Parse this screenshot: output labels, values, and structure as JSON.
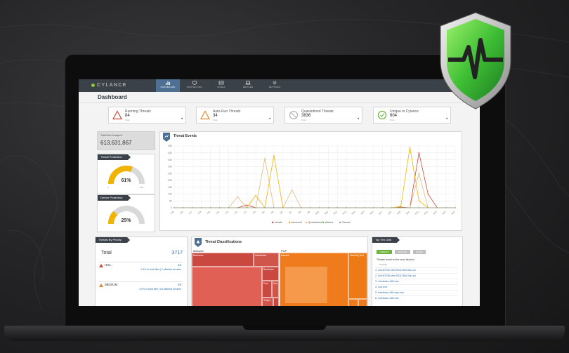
{
  "app": {
    "brand": "CYLANCE",
    "page_title": "Dashboard"
  },
  "nav": [
    {
      "label": "DASHBOARD",
      "icon": "bar-chart-icon",
      "active": true
    },
    {
      "label": "PROTECTION",
      "icon": "shield-icon",
      "active": false
    },
    {
      "label": "ZONES",
      "icon": "zones-icon",
      "active": false
    },
    {
      "label": "DEVICES",
      "icon": "laptop-icon",
      "active": false
    },
    {
      "label": "SETTINGS",
      "icon": "gear-icon",
      "active": false
    }
  ],
  "stats": [
    {
      "label": "Running Threats",
      "value": "84",
      "sub": "Total",
      "icon": "warning-icon",
      "color": "#d0463b"
    },
    {
      "label": "Auto-Run Threats",
      "value": "34",
      "sub": "Total",
      "icon": "warning-icon",
      "color": "#e08a2b"
    },
    {
      "label": "Quarantined Threats",
      "value": "3836",
      "sub": "Total",
      "icon": "blocked-icon",
      "color": "#b5b5b5"
    },
    {
      "label": "Unique to Cylance",
      "value": "604",
      "sub": "Total",
      "icon": "cylance-icon",
      "color": "#6bb33a"
    }
  ],
  "files": {
    "label": "Total Files Analyzed",
    "value": "613,631,867"
  },
  "gauges": {
    "threat": {
      "title": "Threat Protection",
      "percent": 61,
      "display": "61%",
      "color": "#f0b400",
      "min": "0",
      "max": "100"
    },
    "device": {
      "title": "Device Protection",
      "percent": 25,
      "display": "25%",
      "color": "#f0b400",
      "min": "0",
      "max": "100"
    }
  },
  "threat_events": {
    "title": "Threat Events",
    "chart_data": {
      "type": "line",
      "x": [
        "7/25",
        "7/26",
        "7/27",
        "7/28",
        "7/29",
        "7/30",
        "7/31",
        "8/1",
        "8/2",
        "8/3",
        "8/4",
        "8/5",
        "8/6",
        "8/7",
        "8/8",
        "8/9",
        "8/10",
        "8/11",
        "8/12",
        "8/13",
        "8/14",
        "8/15",
        "8/16",
        "8/17",
        "8/18",
        "8/19",
        "8/20",
        "8/21",
        "8/22",
        "8/23",
        "8/24",
        "8/25"
      ],
      "ylim": [
        0,
        450
      ],
      "yticks": [
        0,
        50,
        100,
        150,
        200,
        250,
        300,
        350,
        400,
        450
      ],
      "series": [
        {
          "name": "Unsafe",
          "color": "#d0463b",
          "values": [
            0,
            0,
            0,
            0,
            0,
            0,
            0,
            0,
            20,
            0,
            0,
            0,
            0,
            0,
            0,
            0,
            0,
            0,
            0,
            0,
            0,
            0,
            0,
            0,
            0,
            5,
            0,
            400,
            100,
            0,
            0,
            0
          ]
        },
        {
          "name": "Abnormal",
          "color": "#f0b400",
          "values": [
            0,
            0,
            0,
            0,
            0,
            0,
            0,
            0,
            0,
            90,
            0,
            380,
            0,
            0,
            0,
            0,
            0,
            0,
            0,
            0,
            0,
            0,
            0,
            0,
            0,
            10,
            440,
            50,
            0,
            0,
            0,
            0
          ]
        },
        {
          "name": "Quarantined",
          "color": "#e4b880",
          "values": [
            0,
            0,
            0,
            0,
            0,
            0,
            0,
            80,
            0,
            0,
            360,
            0,
            0,
            130,
            0,
            0,
            0,
            0,
            0,
            0,
            0,
            0,
            0,
            0,
            0,
            0,
            0,
            250,
            0,
            0,
            0,
            0
          ]
        },
        {
          "name": "Waived",
          "color": "#6bb33a",
          "values": [
            0,
            0,
            0,
            0,
            0,
            0,
            0,
            0,
            0,
            0,
            0,
            0,
            0,
            0,
            0,
            0,
            0,
            0,
            0,
            0,
            0,
            0,
            0,
            0,
            0,
            0,
            0,
            0,
            0,
            0,
            0,
            0
          ]
        },
        {
          "name": "Cleared",
          "color": "#9e9e9e",
          "values": [
            0,
            0,
            0,
            0,
            0,
            0,
            0,
            0,
            0,
            0,
            0,
            0,
            0,
            0,
            0,
            0,
            0,
            0,
            0,
            0,
            0,
            0,
            0,
            0,
            0,
            0,
            0,
            0,
            0,
            0,
            0,
            0
          ]
        }
      ]
    }
  },
  "priority": {
    "title": "Threats By Priority",
    "total_label": "Total",
    "total_value": "3717",
    "rows": [
      {
        "name": "HIG...",
        "count": "12",
        "detail": "0.3% of total files | 2 affected devices"
      },
      {
        "name": "MEDIUM",
        "count": "25",
        "detail": "0.9% of total files | 18 affected devices"
      }
    ]
  },
  "classifications": {
    "title": "Threat Classifications",
    "groups": [
      "Malware",
      "PUP"
    ],
    "cells": [
      "Backdoor",
      "Infostealer",
      "Adware",
      "Hacking Tool",
      "Backdoor",
      "Dow",
      "Viru",
      "Trojan"
    ]
  },
  "top_ten": {
    "title": "Top Ten Lists",
    "tabs": [
      "THREATS",
      "DEVICES",
      "ZONES"
    ],
    "subtitle": "Threats found on the most devices",
    "header": "FILE NA",
    "rows": [
      "1. 0c240702.vbn.00012944.5a.out",
      "2. 0c240708.vbn.00012944.5a.out",
      "3. mimikatz-x86.exe",
      "4. ncs.exe",
      "5. mimikatz-x86.asp.exe",
      "6. mimikatz-x86.exe"
    ]
  }
}
